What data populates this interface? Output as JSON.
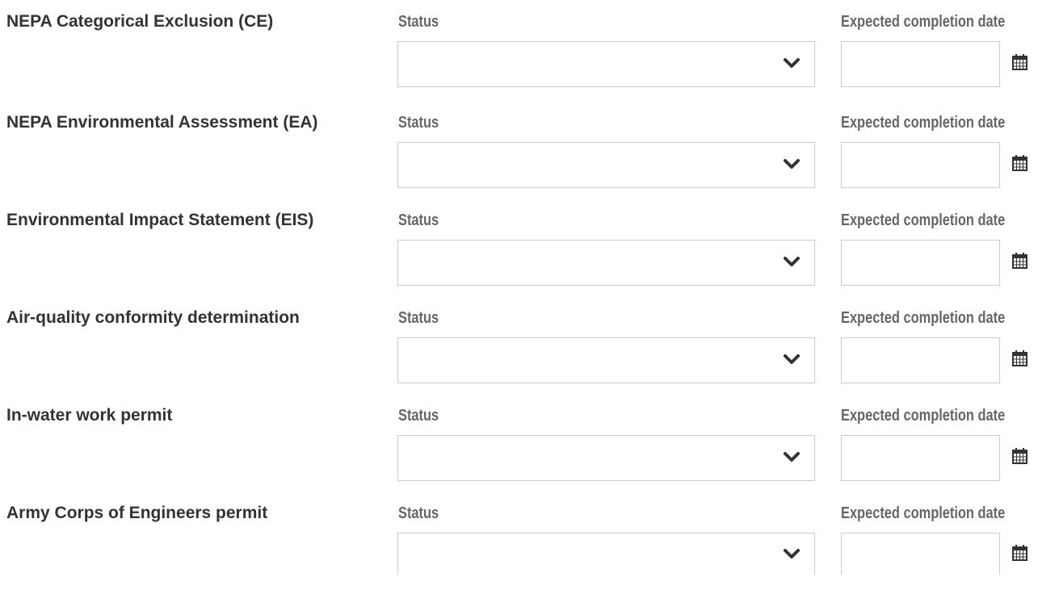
{
  "rows": [
    {
      "label": "NEPA Categorical Exclusion (CE)",
      "status_heading": "Status",
      "status_value": "",
      "date_heading": "Expected completion date",
      "date_value": ""
    },
    {
      "label": "NEPA Environmental Assessment (EA)",
      "status_heading": "Status",
      "status_value": "",
      "date_heading": "Expected completion date",
      "date_value": ""
    },
    {
      "label": "Environmental Impact Statement (EIS)",
      "status_heading": "Status",
      "status_value": "",
      "date_heading": "Expected completion date",
      "date_value": ""
    },
    {
      "label": "Air-quality conformity determination",
      "status_heading": "Status",
      "status_value": "",
      "date_heading": "Expected completion date",
      "date_value": ""
    },
    {
      "label": "In-water work permit",
      "status_heading": "Status",
      "status_value": "",
      "date_heading": "Expected completion date",
      "date_value": ""
    },
    {
      "label": "Army Corps of Engineers permit",
      "status_heading": "Status",
      "status_value": "",
      "date_heading": "Expected completion date",
      "date_value": ""
    }
  ],
  "icons": {
    "status_dropdown": "chevron-down-icon",
    "date_picker": "calendar-icon"
  },
  "colors": {
    "label_text": "#333333",
    "heading_text": "#666666",
    "field_border": "#cccccc",
    "icon": "#333333"
  }
}
